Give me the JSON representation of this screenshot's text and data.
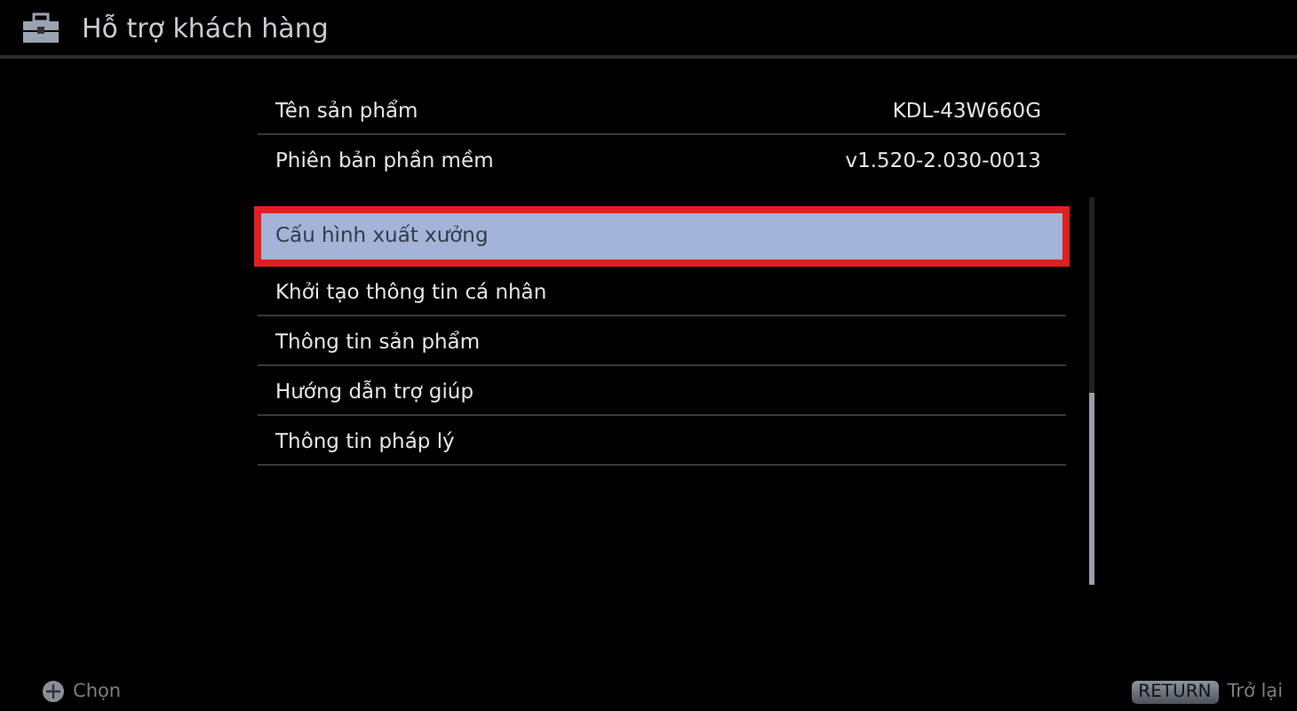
{
  "header": {
    "title": "Hỗ trợ khách hàng"
  },
  "info": [
    {
      "label": "Tên sản phẩm",
      "value": "KDL-43W660G"
    },
    {
      "label": "Phiên bản phần mềm",
      "value": "v1.520-2.030-0013"
    }
  ],
  "menu": [
    {
      "label": "Cấu hình xuất xưởng",
      "selected": true
    },
    {
      "label": "Khởi tạo thông tin cá nhân",
      "selected": false
    },
    {
      "label": "Thông tin sản phẩm",
      "selected": false
    },
    {
      "label": "Hướng dẫn trợ giúp",
      "selected": false
    },
    {
      "label": "Thông tin pháp lý",
      "selected": false
    }
  ],
  "footer": {
    "select_hint": "Chọn",
    "return_key": "RETURN",
    "return_hint": "Trở lại"
  }
}
